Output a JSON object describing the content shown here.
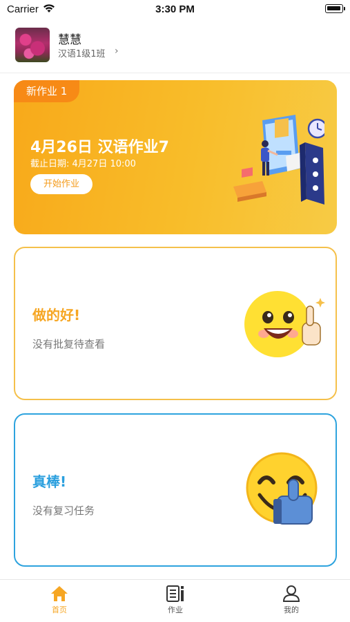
{
  "status": {
    "carrier": "Carrier",
    "time": "3:30 PM"
  },
  "profile": {
    "name": "慧慧",
    "class_name": "汉语1级1班",
    "chevron": "›"
  },
  "homework_card": {
    "tag": "新作业 1",
    "title": "4月26日 汉语作业7",
    "deadline": "截止日期: 4月27日 10:00",
    "start_label": "开始作业"
  },
  "review_card": {
    "title": "做的好!",
    "subtitle": "没有批复待查看"
  },
  "practice_card": {
    "title": "真棒!",
    "subtitle": "没有复习任务"
  },
  "tabbar": {
    "items": [
      {
        "label": "首页",
        "icon": "home-icon",
        "active": true
      },
      {
        "label": "作业",
        "icon": "homework-icon",
        "active": false
      },
      {
        "label": "我的",
        "icon": "profile-icon",
        "active": false
      }
    ]
  },
  "colors": {
    "orange": "#f6a623",
    "tag_orange": "#f78a16",
    "blue": "#2a9fde",
    "card_yellow": "#f8bd2a"
  }
}
